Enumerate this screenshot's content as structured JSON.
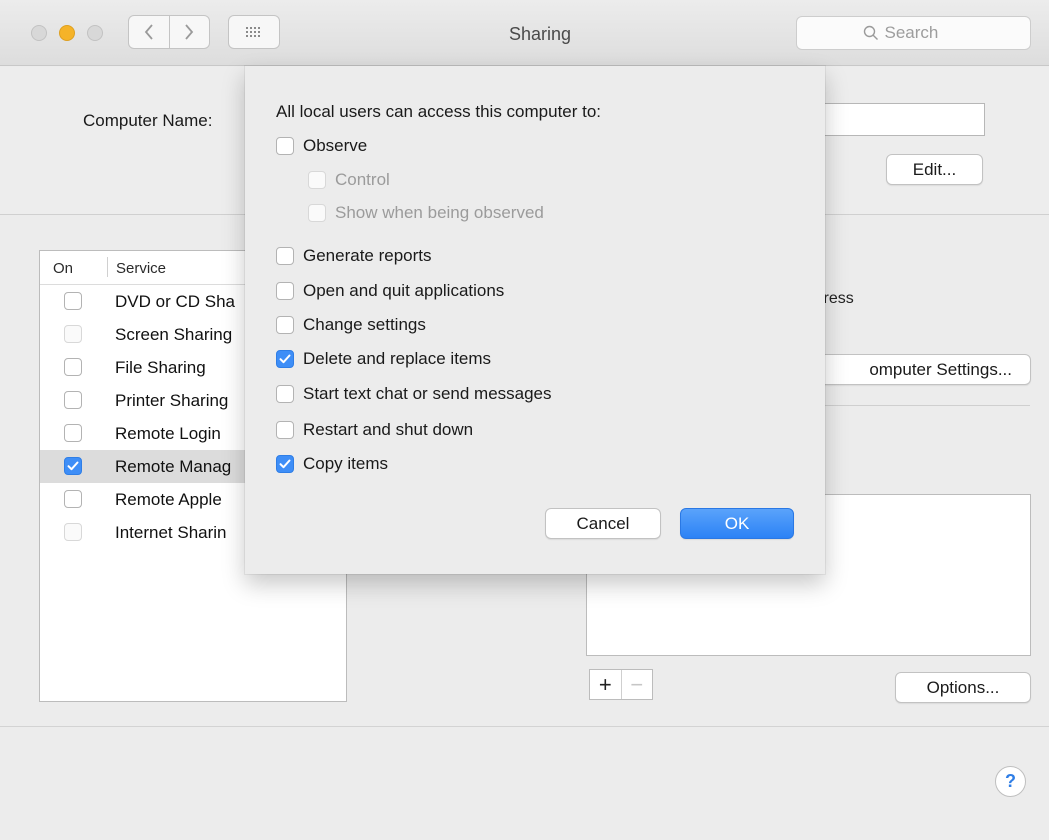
{
  "window": {
    "title": "Sharing"
  },
  "toolbar": {
    "back_icon": "chevron-left-icon",
    "forward_icon": "chevron-right-icon",
    "grid_icon": "grid-icon",
    "search_placeholder": "Search"
  },
  "computer": {
    "name_label": "Computer Name:",
    "name_value": "",
    "edit_label": "Edit..."
  },
  "services": {
    "col_on": "On",
    "col_service": "Service",
    "items": [
      {
        "name": "DVD or CD Sha",
        "checked": false,
        "enabled": true
      },
      {
        "name": "Screen Sharing",
        "checked": false,
        "enabled": false
      },
      {
        "name": "File Sharing",
        "checked": false,
        "enabled": true
      },
      {
        "name": "Printer Sharing",
        "checked": false,
        "enabled": true
      },
      {
        "name": "Remote Login",
        "checked": false,
        "enabled": true
      },
      {
        "name": "Remote Manag",
        "checked": true,
        "enabled": true,
        "selected": true
      },
      {
        "name": "Remote Apple",
        "checked": false,
        "enabled": true
      },
      {
        "name": "Internet Sharin",
        "checked": false,
        "enabled": false
      }
    ]
  },
  "right_panel": {
    "address_fragment": "lress",
    "computer_settings_label": "omputer Settings...",
    "add_label": "+",
    "remove_label": "−",
    "options_label": "Options...",
    "help_label": "?"
  },
  "sheet": {
    "heading": "All local users can access this computer to:",
    "observe": {
      "label": "Observe",
      "checked": false
    },
    "control": {
      "label": "Control",
      "checked": false,
      "enabled": false
    },
    "show_observed": {
      "label": "Show when being observed",
      "checked": false,
      "enabled": false
    },
    "generate_reports": {
      "label": "Generate reports",
      "checked": false
    },
    "open_quit": {
      "label": "Open and quit applications",
      "checked": false
    },
    "change_settings": {
      "label": "Change settings",
      "checked": false
    },
    "delete_replace": {
      "label": "Delete and replace items",
      "checked": true
    },
    "text_chat": {
      "label": "Start text chat or send messages",
      "checked": false
    },
    "restart_shutdown": {
      "label": "Restart and shut down",
      "checked": false
    },
    "copy_items": {
      "label": "Copy items",
      "checked": true
    },
    "cancel_label": "Cancel",
    "ok_label": "OK"
  },
  "colors": {
    "accent": "#3e8ef7",
    "traffic_minimize": "#f5b328"
  }
}
